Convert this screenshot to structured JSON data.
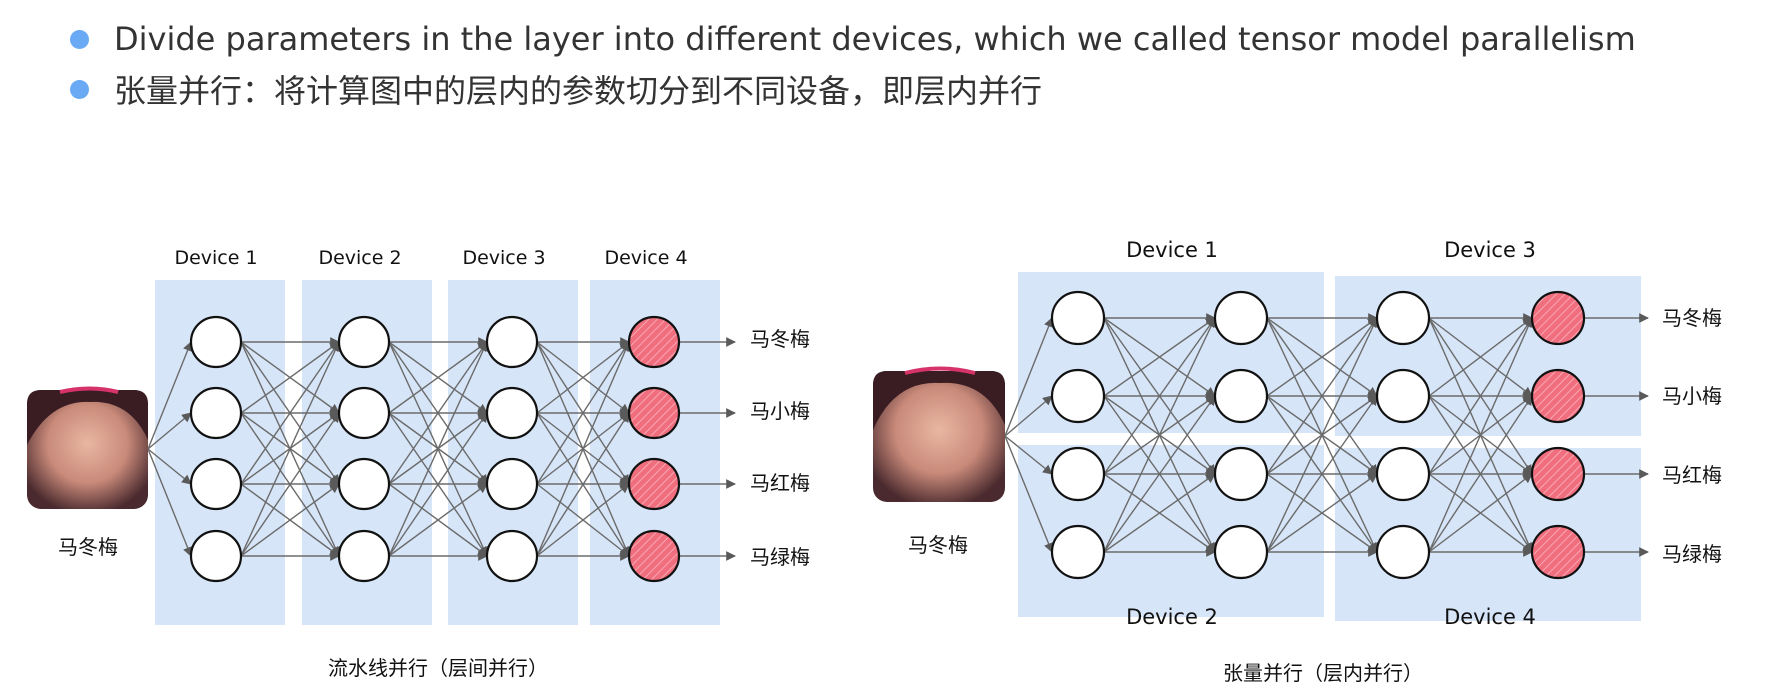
{
  "bullets": [
    "Divide parameters in the layer into different devices, which we called tensor model parallelism",
    "张量并行：将计算图中的层内的参数切分到不同设备，即层内并行"
  ],
  "colors": {
    "bullet": "#6aaaf5",
    "panel": "#d6e5f7",
    "output_neuron": "#f06e7e",
    "edge": "#6b6b6b"
  },
  "left_diagram": {
    "devices": [
      "Device 1",
      "Device 2",
      "Device 3",
      "Device 4"
    ],
    "input_label": "马冬梅",
    "outputs": [
      "马冬梅",
      "马小梅",
      "马红梅",
      "马绿梅"
    ],
    "caption": "流水线并行（层间并行）"
  },
  "right_diagram": {
    "devices_top": [
      "Device 1",
      "Device 3"
    ],
    "devices_bottom": [
      "Device 2",
      "Device 4"
    ],
    "input_label": "马冬梅",
    "outputs": [
      "马冬梅",
      "马小梅",
      "马红梅",
      "马绿梅"
    ],
    "caption": "张量并行（层内并行）"
  }
}
